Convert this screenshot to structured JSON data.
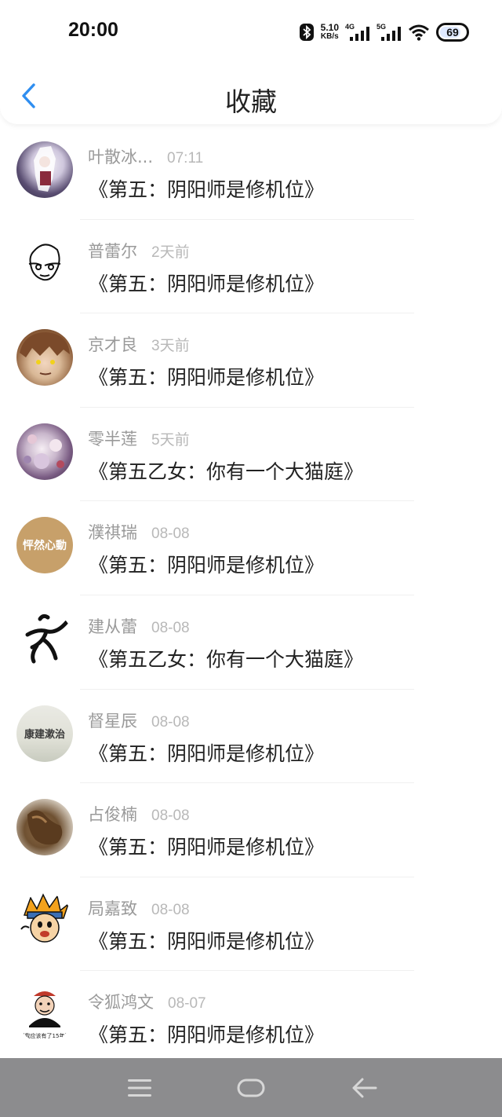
{
  "status_bar": {
    "time": "20:00",
    "net_speed_value": "5.10",
    "net_speed_unit": "KB/s",
    "signal1_label": "4G",
    "signal2_label": "5G",
    "battery": "69",
    "icons": [
      "bluetooth-icon",
      "signal-4g-icon",
      "signal-5g-icon",
      "wifi-icon",
      "battery-icon"
    ]
  },
  "header": {
    "title": "收藏",
    "back_icon": "chevron-left-icon",
    "accent_color": "#2f8ef0"
  },
  "favorites": [
    {
      "user": "叶散冰...",
      "time": "07:11",
      "book": "《第五：阴阳师是修机位》"
    },
    {
      "user": "普蕾尔",
      "time": "2天前",
      "book": "《第五：阴阳师是修机位》"
    },
    {
      "user": "京才良",
      "time": "3天前",
      "book": "《第五：阴阳师是修机位》"
    },
    {
      "user": "零半莲",
      "time": "5天前",
      "book": "《第五乙女：你有一个大猫庭》"
    },
    {
      "user": "濮祺瑞",
      "time": "08-08",
      "book": "《第五：阴阳师是修机位》",
      "avatar_text": "怦然心動"
    },
    {
      "user": "建从蕾",
      "time": "08-08",
      "book": "《第五乙女：你有一个大猫庭》"
    },
    {
      "user": "督星辰",
      "time": "08-08",
      "book": "《第五：阴阳师是修机位》",
      "avatar_text": "康建漱治"
    },
    {
      "user": "占俊楠",
      "time": "08-08",
      "book": "《第五：阴阳师是修机位》"
    },
    {
      "user": "局嘉致",
      "time": "08-08",
      "book": "《第五：阴阳师是修机位》"
    },
    {
      "user": "令狐鸿文",
      "time": "08-07",
      "book": "《第五：阴阳师是修机位》",
      "avatar_text": "那我应该有了15年了"
    }
  ],
  "nav_bar": {
    "icons": [
      "menu-icon",
      "home-icon",
      "back-arrow-icon"
    ],
    "background": "#8c8c8e"
  }
}
